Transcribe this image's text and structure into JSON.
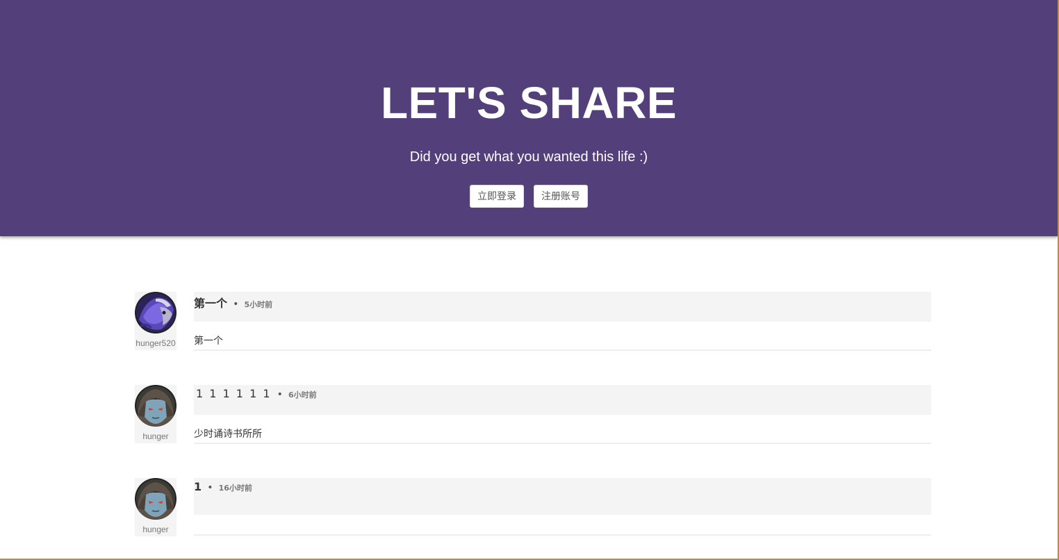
{
  "hero": {
    "title": "LET'S SHARE",
    "subtitle": "Did you get what you wanted this life :)",
    "login_label": "立即登录",
    "register_label": "注册账号",
    "background": "#533f7a"
  },
  "posts": [
    {
      "author": "hunger520",
      "avatar": "purple-warrior-avatar",
      "title": "第一个",
      "separator": "•",
      "time": "5小时前",
      "content": "第一个"
    },
    {
      "author": "hunger",
      "avatar": "hooded-elf-avatar",
      "title": "1 1 1 1 1 1",
      "separator": "•",
      "time": "6小时前",
      "content": "少时诵诗书所所"
    },
    {
      "author": "hunger",
      "avatar": "hooded-elf-avatar",
      "title": "1",
      "separator": "•",
      "time": "16小时前",
      "content": ""
    }
  ]
}
